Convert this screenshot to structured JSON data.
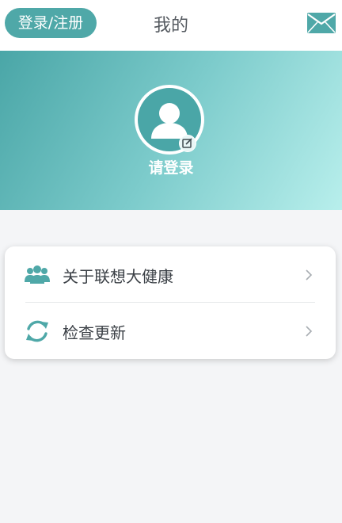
{
  "header": {
    "login_button": "登录/注册",
    "title": "我的",
    "mail_icon": "mail-icon"
  },
  "profile": {
    "avatar_icon": "user-avatar-icon",
    "edit_icon": "edit-icon",
    "prompt": "请登录"
  },
  "menu": {
    "items": [
      {
        "label": "关于联想大健康",
        "icon": "group-icon"
      },
      {
        "label": "检查更新",
        "icon": "refresh-icon"
      }
    ]
  },
  "colors": {
    "accent": "#4fa8a8",
    "banner_start": "#4aa6a7",
    "banner_end": "#b8efec",
    "background": "#f4f5f7"
  }
}
